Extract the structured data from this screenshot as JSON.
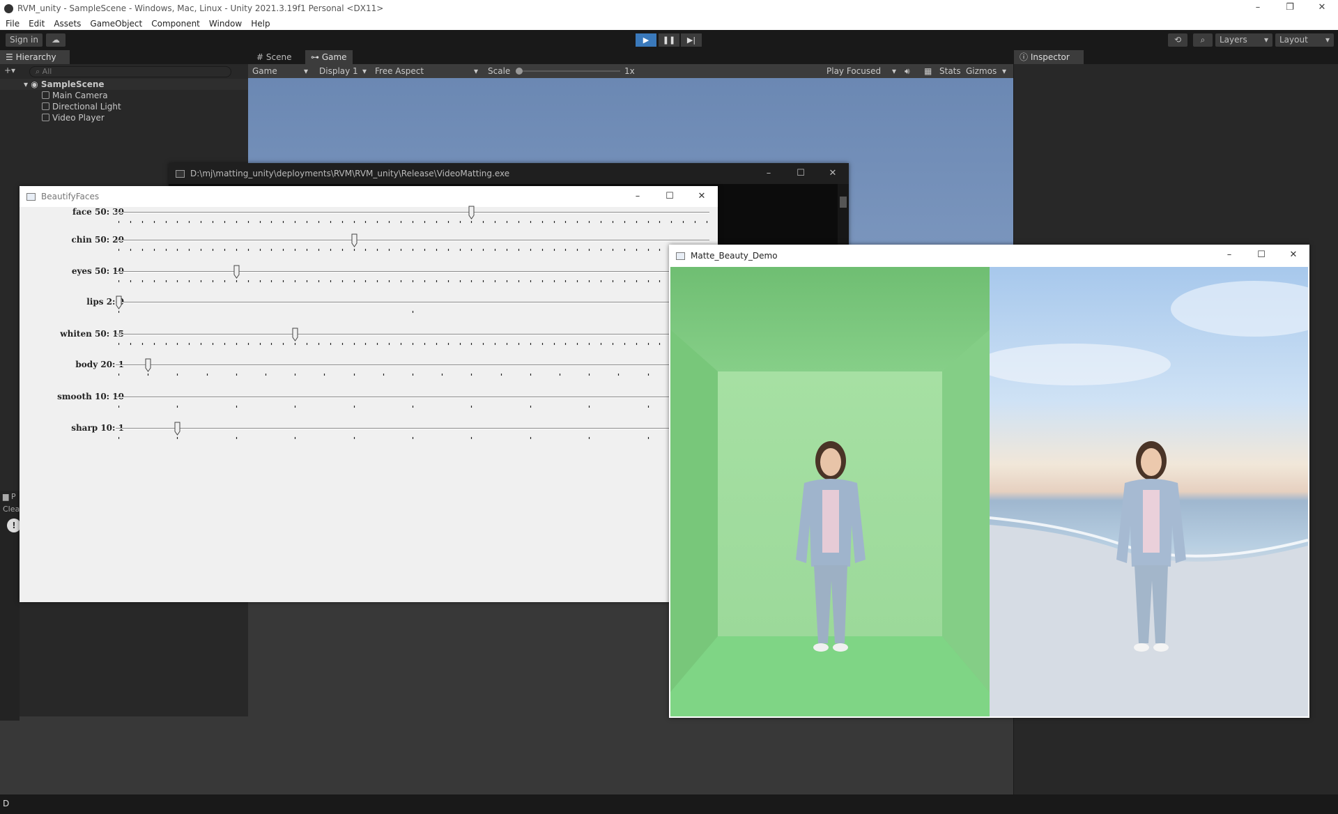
{
  "app": {
    "window_title": "RVM_unity - SampleScene - Windows, Mac, Linux - Unity 2021.3.19f1 Personal <DX11>",
    "menu": [
      "File",
      "Edit",
      "Assets",
      "GameObject",
      "Component",
      "Window",
      "Help"
    ],
    "toolbar": {
      "sign_in": "Sign in",
      "layers": "Layers",
      "layout": "Layout"
    }
  },
  "hierarchy": {
    "tab": "Hierarchy",
    "search_placeholder": "All",
    "scene": "SampleScene",
    "items": [
      "Main Camera",
      "Directional Light",
      "Video Player"
    ]
  },
  "game_view": {
    "tabs": [
      "Scene",
      "Game"
    ],
    "game_dropdown": "Game",
    "display": "Display 1",
    "aspect": "Free Aspect",
    "scale_label": "Scale",
    "scale_value": "1x",
    "play_focused": "Play Focused",
    "stats": "Stats",
    "gizmos": "Gizmos"
  },
  "inspector": {
    "tab": "Inspector"
  },
  "console": {
    "tab": "P",
    "clear": "Clea"
  },
  "statusbar": {
    "text": "D"
  },
  "console_window": {
    "title": "D:\\mj\\matting_unity\\deployments\\RVM\\RVM_unity\\Release\\VideoMatting.exe"
  },
  "beautify_window": {
    "title": "BeautifyFaces",
    "sliders": [
      {
        "label": "face 50: 30",
        "max": 50,
        "value": 30
      },
      {
        "label": "chin 50: 20",
        "max": 50,
        "value": 20
      },
      {
        "label": "eyes 50: 10",
        "max": 50,
        "value": 10
      },
      {
        "label": "lips 2: 0",
        "max": 2,
        "value": 0
      },
      {
        "label": "whiten 50: 15",
        "max": 50,
        "value": 15
      },
      {
        "label": "body 20: 1",
        "max": 20,
        "value": 1
      },
      {
        "label": "smooth 10: 10",
        "max": 10,
        "value": 10
      },
      {
        "label": "sharp 10: 1",
        "max": 10,
        "value": 1
      }
    ]
  },
  "demo_window": {
    "title": "Matte_Beauty_Demo"
  },
  "colors": {
    "unity_dark": "#282828",
    "play_blue": "#3a79bb",
    "green_screen": "#8cd68e",
    "sky": "#a9c9ea"
  }
}
